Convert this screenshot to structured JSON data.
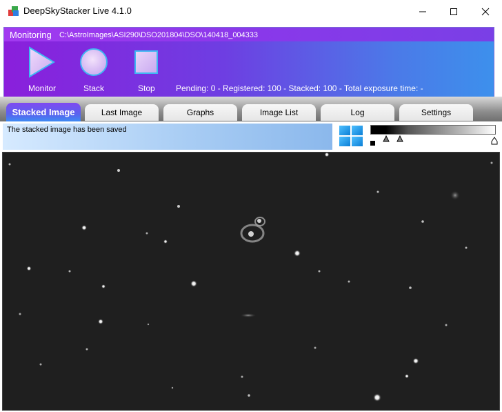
{
  "window": {
    "title": "DeepSkyStacker Live 4.1.0",
    "controls": {
      "minimize": "minimize-icon",
      "maximize": "maximize-icon",
      "close": "close-icon"
    }
  },
  "monitoring": {
    "label": "Monitoring",
    "path": "C:\\AstroImages\\ASI290\\DSO201804\\DSO\\140418_004333",
    "buttons": {
      "monitor": "Monitor",
      "stack": "Stack",
      "stop": "Stop"
    },
    "status": "Pending: 0 - Registered: 100 - Stacked: 100 - Total exposure time: -"
  },
  "tabs": [
    {
      "label": "Stacked Image",
      "active": true
    },
    {
      "label": "Last Image"
    },
    {
      "label": "Graphs"
    },
    {
      "label": "Image List"
    },
    {
      "label": "Log"
    },
    {
      "label": "Settings"
    }
  ],
  "info": {
    "message": "The stacked image has been saved"
  },
  "colors": {
    "panel_start": "#8a1fdc",
    "panel_end": "#3d90ec",
    "image_background": "#1e1e1e"
  }
}
